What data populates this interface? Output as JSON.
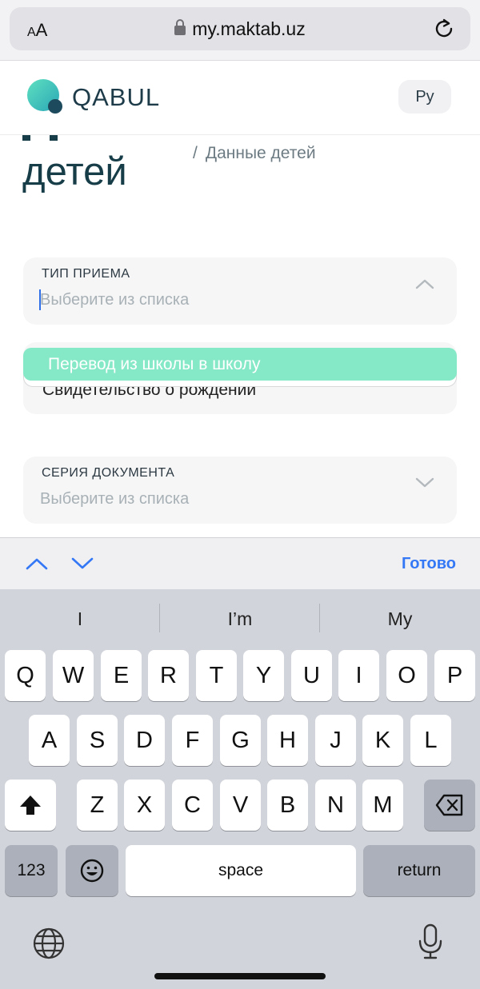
{
  "browser": {
    "aa_label_small": "A",
    "aa_label_large": "A",
    "url": "my.maktab.uz"
  },
  "header": {
    "logo_text": "QABUL",
    "language_button": "Ру"
  },
  "page": {
    "title_fragment": "детей",
    "breadcrumb_separator": "/",
    "breadcrumb_current": "Данные детей"
  },
  "form": {
    "admission_type": {
      "label": "ТИП ПРИЕМА",
      "placeholder": "Выберите из списка"
    },
    "dropdown": {
      "highlighted_option": "Перевод из школы в школу",
      "underlying_text": "Свидетельство о рождении"
    },
    "document_series": {
      "label": "СЕРИЯ ДОКУМЕНТА",
      "placeholder": "Выберите из списка"
    }
  },
  "accessory": {
    "done_label": "Готово"
  },
  "keyboard": {
    "suggestions": [
      "I",
      "I’m",
      "My"
    ],
    "row1": [
      "Q",
      "W",
      "E",
      "R",
      "T",
      "Y",
      "U",
      "I",
      "O",
      "P"
    ],
    "row2": [
      "A",
      "S",
      "D",
      "F",
      "G",
      "H",
      "J",
      "K",
      "L"
    ],
    "row3": [
      "Z",
      "X",
      "C",
      "V",
      "B",
      "N",
      "M"
    ],
    "numbers_label": "123",
    "space_label": "space",
    "return_label": "return"
  },
  "colors": {
    "accent_blue": "#3478f6",
    "highlight_green": "#85e8c6",
    "title_dark": "#173d48"
  }
}
